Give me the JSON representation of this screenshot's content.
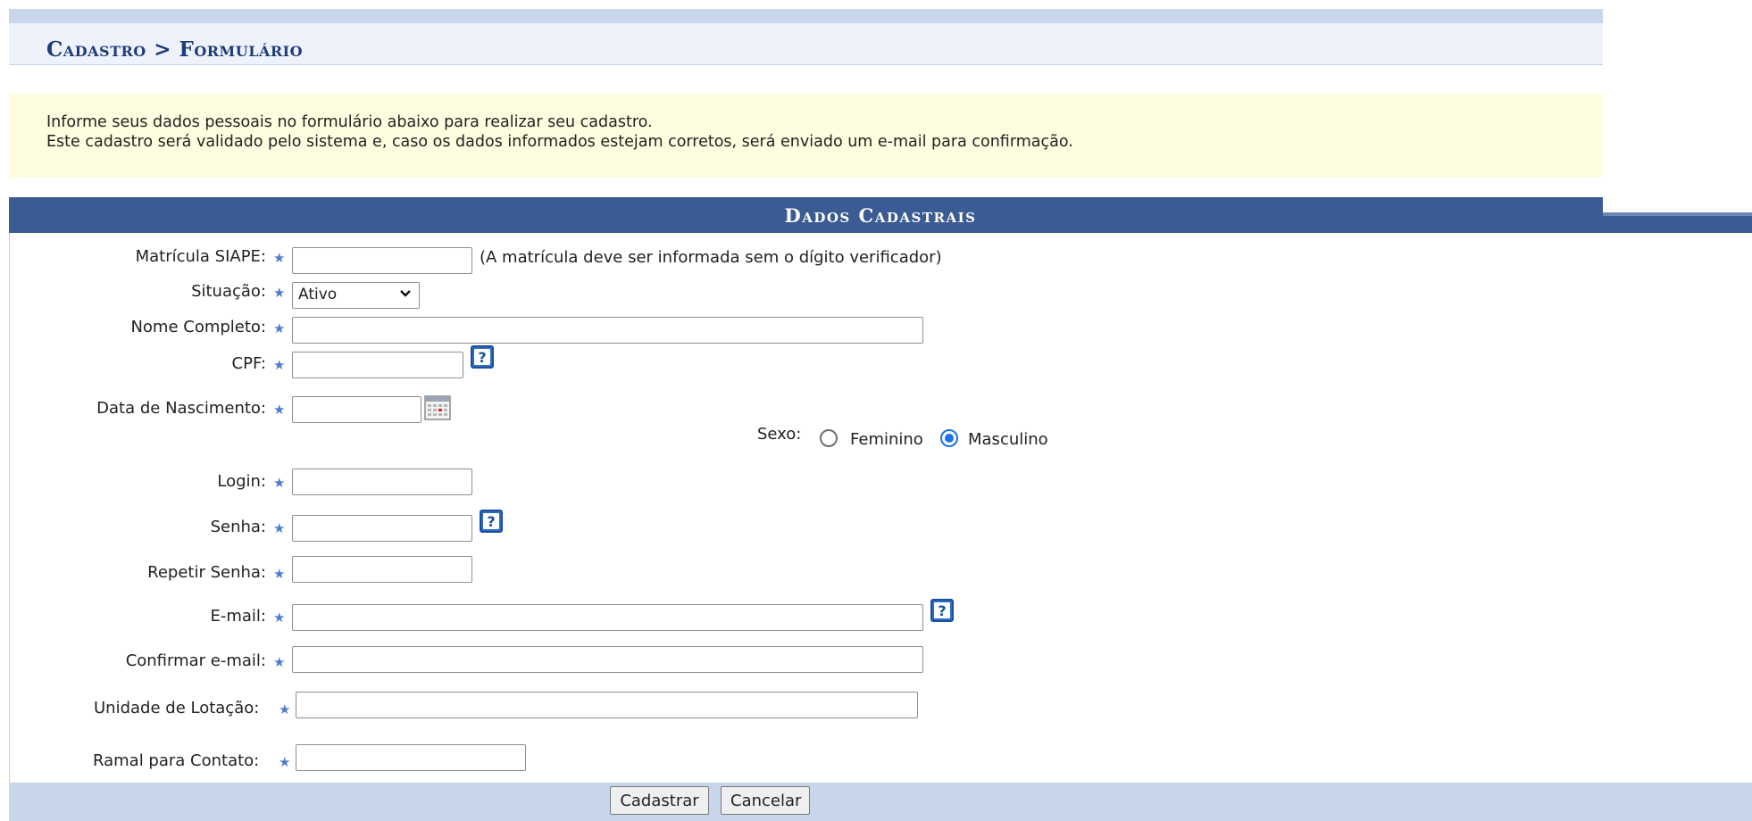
{
  "breadcrumb": "Cadastro > Formulário",
  "info": {
    "line1": "Informe seus dados pessoais no formulário abaixo para realizar seu cadastro.",
    "line2": "Este cadastro será validado pelo sistema e, caso os dados informados estejam corretos, será enviado um e-mail para confirmação."
  },
  "section_title": "Dados Cadastrais",
  "required_mark": "★",
  "fields": {
    "matricula": {
      "label": "Matrícula SIAPE:",
      "value": "",
      "note": "(A matrícula deve ser informada sem o dígito verificador)"
    },
    "situacao": {
      "label": "Situação:",
      "selected": "Ativo"
    },
    "nome": {
      "label": "Nome Completo:",
      "value": ""
    },
    "cpf": {
      "label": "CPF:",
      "value": ""
    },
    "nascimento": {
      "label": "Data de Nascimento:",
      "value": ""
    },
    "sexo": {
      "label": "Sexo:",
      "options": [
        "Feminino",
        "Masculino"
      ],
      "selected": "Masculino"
    },
    "login": {
      "label": "Login:",
      "value": ""
    },
    "senha": {
      "label": "Senha:",
      "value": ""
    },
    "repetir_senha": {
      "label": "Repetir Senha:",
      "value": ""
    },
    "email": {
      "label": "E-mail:",
      "value": ""
    },
    "confirmar_email": {
      "label": "Confirmar e-mail:",
      "value": ""
    },
    "unidade": {
      "label": "Unidade de Lotação:",
      "value": ""
    },
    "ramal": {
      "label": "Ramal para Contato:",
      "value": ""
    }
  },
  "help_icon_text": "?",
  "buttons": {
    "submit": "Cadastrar",
    "cancel": "Cancelar"
  },
  "colors": {
    "header_bg": "#3b5b93",
    "breadcrumb_text": "#1f3c78",
    "info_bg": "#fffde0",
    "bar_bg": "#c8d6ec",
    "star": "#4d7bd1",
    "help_icon": "#2b6cc4",
    "radio_checked": "#1a73e8"
  }
}
